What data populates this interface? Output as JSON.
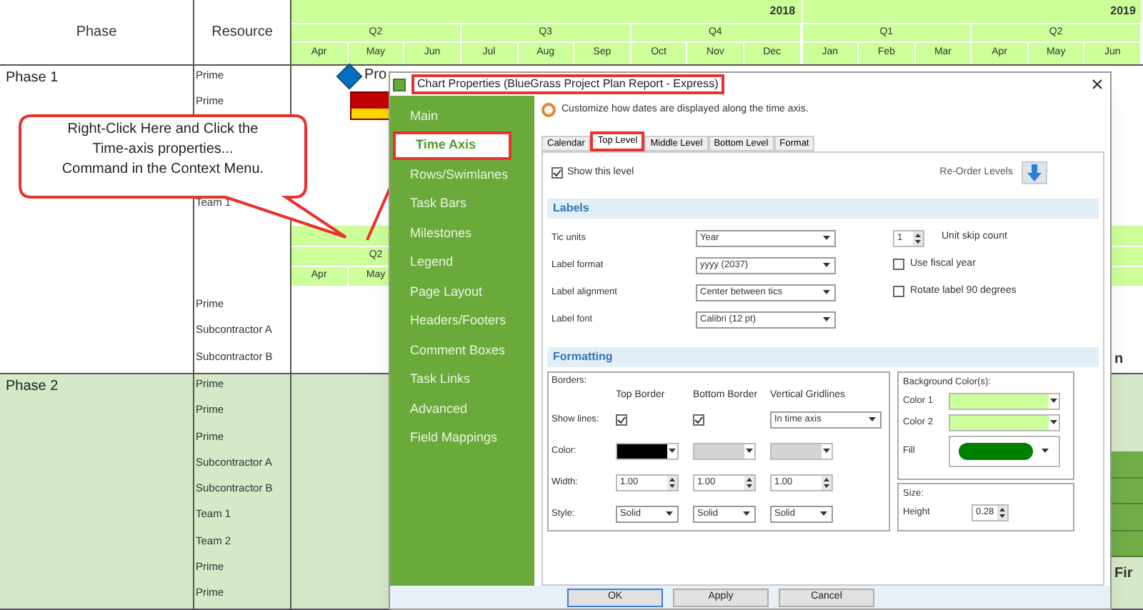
{
  "gantt": {
    "columns": [
      "Phase",
      "Resource"
    ],
    "years": [
      {
        "label": "2018",
        "quarters": [
          {
            "label": "Q2",
            "months": [
              "Apr",
              "May",
              "Jun"
            ]
          },
          {
            "label": "Q3",
            "months": [
              "Jul",
              "Aug",
              "Sep"
            ]
          },
          {
            "label": "Q4",
            "months": [
              "Oct",
              "Nov",
              "Dec"
            ]
          }
        ]
      },
      {
        "label": "2019",
        "quarters": [
          {
            "label": "Q1",
            "months": [
              "Jan",
              "Feb",
              "Mar"
            ]
          },
          {
            "label": "Q2",
            "months": [
              "Apr",
              "May",
              "Jun"
            ]
          }
        ]
      }
    ],
    "phases": [
      {
        "name": "Phase 1",
        "shaded": false,
        "resource_groups": [
          [
            "Prime",
            "Prime"
          ],
          [
            "Team 1"
          ],
          [
            "Prime",
            "Subcontractor A",
            "Subcontractor B"
          ]
        ],
        "repeat_header": {
          "quarter": "Q2",
          "months": [
            "Apr",
            "May"
          ]
        },
        "milestone": {
          "label": "Pro"
        },
        "task_label": "n"
      },
      {
        "name": "Phase 2",
        "shaded": true,
        "resource_groups": [
          [
            "Prime",
            "Prime",
            "Prime",
            "Subcontractor A",
            "Subcontractor B",
            "Team 1",
            "Team 2",
            "Prime",
            "Prime"
          ]
        ],
        "task_label": "Fir"
      }
    ]
  },
  "callout": {
    "text_lines": [
      "Right-Click Here and Click the",
      "Time-axis properties...",
      "Command in the Context Menu."
    ]
  },
  "dialog": {
    "title": "Chart Properties (BlueGrass Project Plan Report - Express)",
    "title_highlighted": true,
    "nav": [
      {
        "label": "Main",
        "selected": false,
        "highlighted": false
      },
      {
        "label": "Time Axis",
        "selected": true,
        "highlighted": true
      },
      {
        "label": "Rows/Swimlanes",
        "selected": false,
        "highlighted": false
      },
      {
        "label": "Task Bars",
        "selected": false,
        "highlighted": false
      },
      {
        "label": "Milestones",
        "selected": false,
        "highlighted": false
      },
      {
        "label": "Legend",
        "selected": false,
        "highlighted": false
      },
      {
        "label": "Page Layout",
        "selected": false,
        "highlighted": false
      },
      {
        "label": "Headers/Footers",
        "selected": false,
        "highlighted": false
      },
      {
        "label": "Comment Boxes",
        "selected": false,
        "highlighted": false
      },
      {
        "label": "Task Links",
        "selected": false,
        "highlighted": false
      },
      {
        "label": "Advanced",
        "selected": false,
        "highlighted": false
      },
      {
        "label": "Field Mappings",
        "selected": false,
        "highlighted": false
      }
    ],
    "description": "Customize how dates are displayed along the time axis.",
    "tabs": [
      {
        "label": "Calendar",
        "selected": false,
        "highlighted": false
      },
      {
        "label": "Top Level",
        "selected": true,
        "highlighted": true
      },
      {
        "label": "Middle Level",
        "selected": false,
        "highlighted": false
      },
      {
        "label": "Bottom Level",
        "selected": false,
        "highlighted": false
      },
      {
        "label": "Format",
        "selected": false,
        "highlighted": false
      }
    ],
    "show_level": {
      "label": "Show this level",
      "checked": true
    },
    "reorder_label": "Re-Order Levels",
    "labels_section": "Labels",
    "label_rows": [
      {
        "label": "Tic units",
        "value": "Year",
        "side": {
          "kind": "spinner",
          "value": "1",
          "label": "Unit skip count"
        }
      },
      {
        "label": "Label format",
        "value": "yyyy (2037)",
        "side": {
          "kind": "checkbox",
          "checked": false,
          "label": "Use fiscal year"
        }
      },
      {
        "label": "Label alignment",
        "value": "Center between tics",
        "side": {
          "kind": "checkbox",
          "checked": false,
          "label": "Rotate label 90 degrees"
        }
      },
      {
        "label": "Label font",
        "value": "Calibri (12 pt)"
      }
    ],
    "formatting_section": "Formatting",
    "borders": {
      "title": "Borders:",
      "columns": [
        "Top Border",
        "Bottom Border",
        "Vertical Gridlines"
      ],
      "rows": [
        {
          "label": "Show lines:",
          "cells": [
            {
              "kind": "checkbox",
              "checked": true
            },
            {
              "kind": "checkbox",
              "checked": true
            },
            {
              "kind": "select",
              "value": "In time axis"
            }
          ]
        },
        {
          "label": "Color:",
          "cells": [
            {
              "kind": "color",
              "color": "#000000"
            },
            {
              "kind": "color",
              "color": "#d4d4d4"
            },
            {
              "kind": "color",
              "color": "#d4d4d4"
            }
          ]
        },
        {
          "label": "Width:",
          "cells": [
            {
              "kind": "spinner",
              "value": "1.00"
            },
            {
              "kind": "spinner",
              "value": "1.00"
            },
            {
              "kind": "spinner",
              "value": "1.00"
            }
          ]
        },
        {
          "label": "Style:",
          "cells": [
            {
              "kind": "select",
              "value": "Solid"
            },
            {
              "kind": "select",
              "value": "Solid"
            },
            {
              "kind": "select",
              "value": "Solid"
            }
          ]
        }
      ]
    },
    "background": {
      "title": "Background Color(s):",
      "rows": [
        {
          "label": "Color 1",
          "kind": "color",
          "color": "#ccff99"
        },
        {
          "label": "Color 2",
          "kind": "color",
          "color": "#ccff99"
        },
        {
          "label": "Fill",
          "kind": "fill",
          "color": "#008000"
        }
      ]
    },
    "size": {
      "title": "Size:",
      "label": "Height",
      "value": "0.28"
    },
    "buttons": [
      {
        "label": "OK",
        "default": true
      },
      {
        "label": "Apply",
        "default": false
      },
      {
        "label": "Cancel",
        "default": false
      }
    ]
  }
}
